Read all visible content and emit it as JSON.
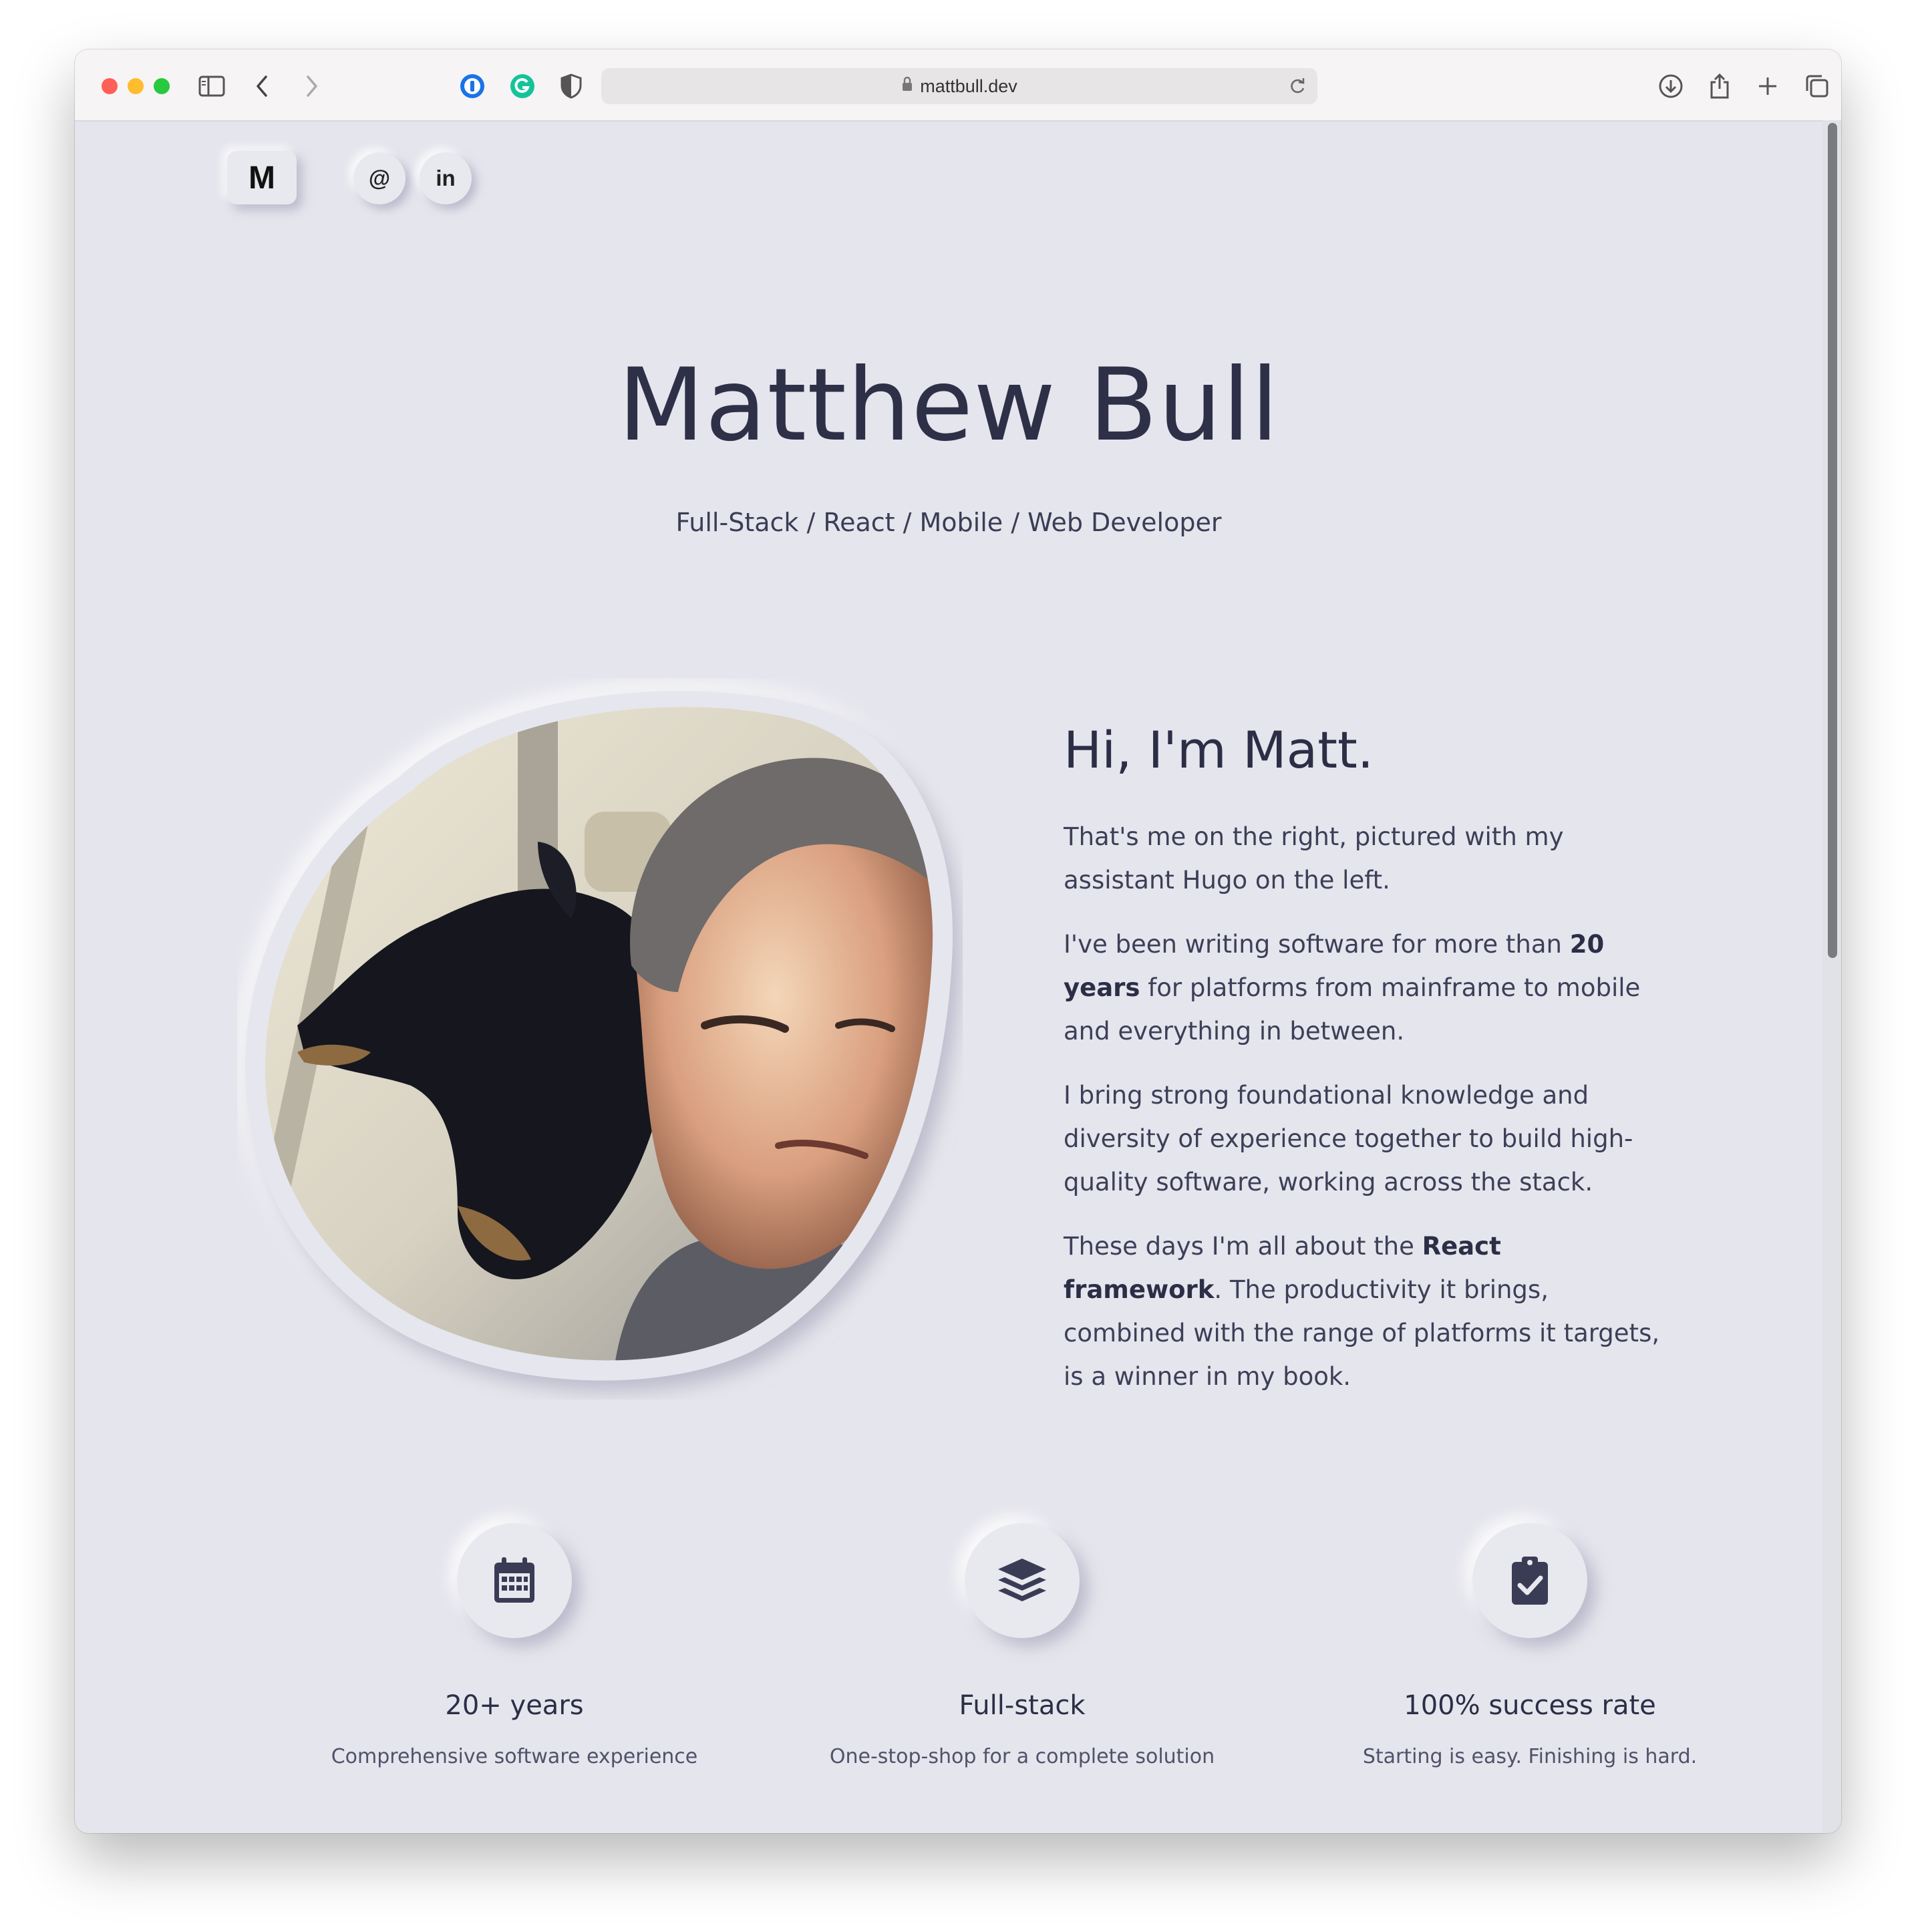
{
  "browser": {
    "url": "mattbull.dev",
    "traffic_lights": [
      "#fe5f57",
      "#febc2e",
      "#28c840"
    ],
    "toolbar_icons": [
      "sidebar-icon",
      "back-icon",
      "forward-icon",
      "password-manager-icon",
      "grammarly-icon",
      "privacy-shield-icon",
      "lock-icon",
      "reload-icon",
      "download-icon",
      "share-icon",
      "new-tab-icon",
      "tab-overview-icon"
    ]
  },
  "nav": {
    "brand": "M",
    "email_label": "@",
    "linkedin_label": "in"
  },
  "hero": {
    "title": "Matthew Bull",
    "subtitle": "Full-Stack / React / Mobile / Web Developer"
  },
  "intro": {
    "heading": "Hi, I'm Matt.",
    "p1": "That's me on the right, pictured with my assistant Hugo on the left.",
    "p2_before": "I've been writing software for more than ",
    "p2_bold": "20 years",
    "p2_after": " for platforms from mainframe to mobile and everything in between.",
    "p3": "I bring strong foundational knowledge and diversity of experience together to build high-quality software, working across the stack.",
    "p4_before": "These days I'm all about the ",
    "p4_bold": "React framework",
    "p4_after": ". The productivity it brings, combined with the range of platforms it targets, is a winner in my book."
  },
  "features": [
    {
      "icon": "calendar-icon",
      "title": "20+ years",
      "description": "Comprehensive software experience"
    },
    {
      "icon": "layers-icon",
      "title": "Full-stack",
      "description": "One-stop-shop for a complete solution"
    },
    {
      "icon": "clipboard-check-icon",
      "title": "100% success rate",
      "description": "Starting is easy. Finishing is hard."
    }
  ],
  "colors": {
    "page_background": "#e5e5ed",
    "text_dark": "#2e3048",
    "icon_color": "#3a3c56"
  }
}
